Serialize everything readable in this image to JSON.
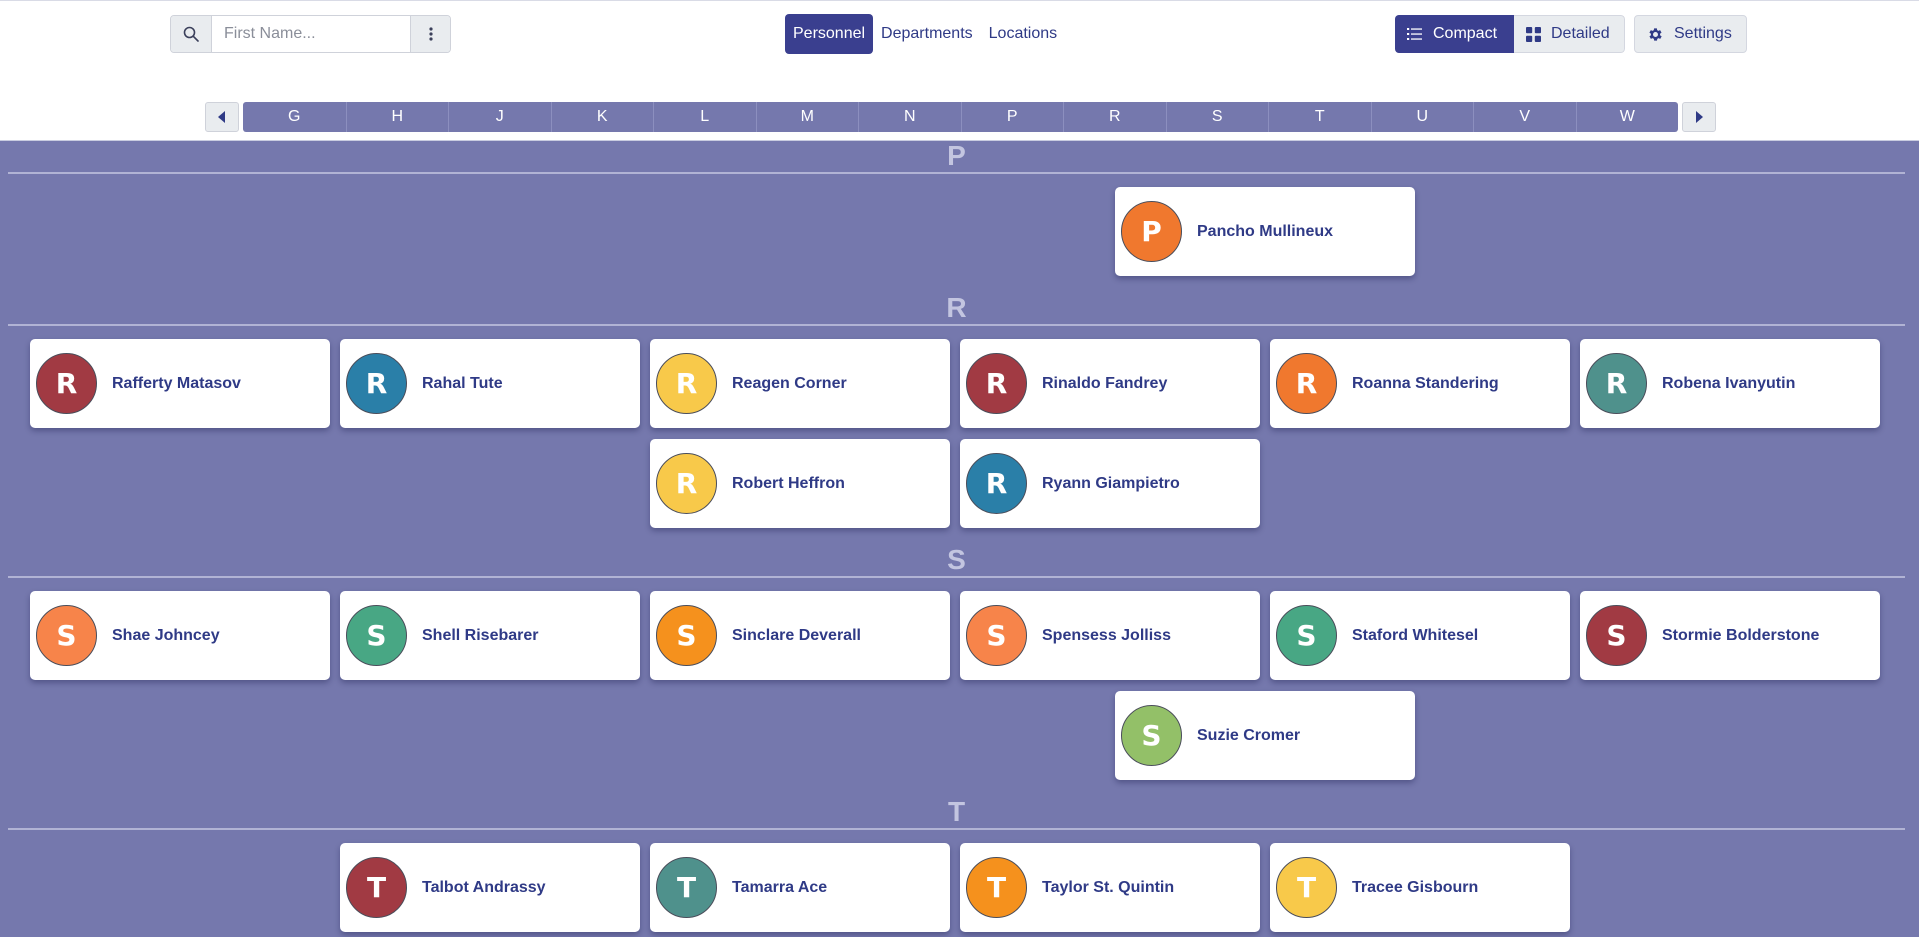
{
  "search": {
    "placeholder": "First Name..."
  },
  "nav": {
    "personnel": "Personnel",
    "departments": "Departments",
    "locations": "Locations"
  },
  "view": {
    "compact": "Compact",
    "detailed": "Detailed",
    "settings": "Settings"
  },
  "letters": [
    "G",
    "H",
    "J",
    "K",
    "L",
    "M",
    "N",
    "P",
    "R",
    "S",
    "T",
    "U",
    "V",
    "W"
  ],
  "colors": {
    "accent": "#3a3f8f",
    "background": "#7578ad",
    "orange": "#f0782e",
    "red": "#a13a43",
    "blue": "#2a7fa8",
    "yellow": "#f8c94a",
    "teal": "#4f918c",
    "green": "#48a784",
    "lightorange": "#f7844a",
    "amber": "#f5911d",
    "lime": "#93c068"
  },
  "groups": [
    {
      "letter": "P",
      "people": [
        {
          "initial": "P",
          "name": "Pancho Mullineux",
          "color": "#f0782e"
        }
      ]
    },
    {
      "letter": "R",
      "people": [
        {
          "initial": "R",
          "name": "Rafferty Matasov",
          "color": "#a13a43"
        },
        {
          "initial": "R",
          "name": "Rahal Tute",
          "color": "#2a7fa8"
        },
        {
          "initial": "R",
          "name": "Reagen Corner",
          "color": "#f8c94a"
        },
        {
          "initial": "R",
          "name": "Rinaldo Fandrey",
          "color": "#a13a43"
        },
        {
          "initial": "R",
          "name": "Roanna Standering",
          "color": "#f0782e"
        },
        {
          "initial": "R",
          "name": "Robena Ivanyutin",
          "color": "#4f918c"
        },
        {
          "initial": "R",
          "name": "Robert Heffron",
          "color": "#f8c94a"
        },
        {
          "initial": "R",
          "name": "Ryann Giampietro",
          "color": "#2a7fa8"
        }
      ]
    },
    {
      "letter": "S",
      "people": [
        {
          "initial": "S",
          "name": "Shae Johncey",
          "color": "#f7844a"
        },
        {
          "initial": "S",
          "name": "Shell Risebarer",
          "color": "#48a784"
        },
        {
          "initial": "S",
          "name": "Sinclare Deverall",
          "color": "#f5911d"
        },
        {
          "initial": "S",
          "name": "Spensess Jolliss",
          "color": "#f7844a"
        },
        {
          "initial": "S",
          "name": "Staford Whitesel",
          "color": "#48a784"
        },
        {
          "initial": "S",
          "name": "Stormie Bolderstone",
          "color": "#a13a43"
        },
        {
          "initial": "S",
          "name": "Suzie Cromer",
          "color": "#93c068"
        }
      ]
    },
    {
      "letter": "T",
      "people": [
        {
          "initial": "T",
          "name": "Talbot Andrassy",
          "color": "#a13a43"
        },
        {
          "initial": "T",
          "name": "Tamarra Ace",
          "color": "#4f918c"
        },
        {
          "initial": "T",
          "name": "Taylor St. Quintin",
          "color": "#f5911d"
        },
        {
          "initial": "T",
          "name": "Tracee Gisbourn",
          "color": "#f8c94a"
        }
      ]
    }
  ]
}
